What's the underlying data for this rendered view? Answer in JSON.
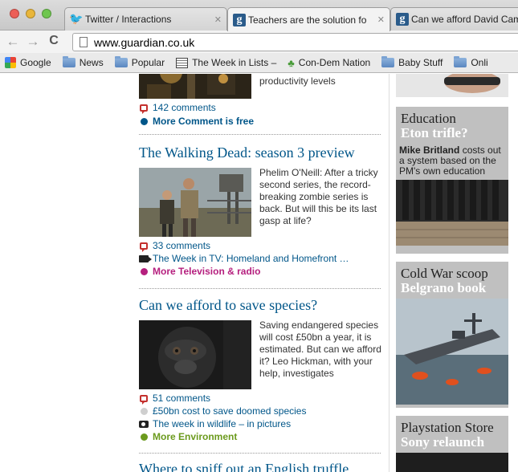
{
  "browser": {
    "tabs": [
      {
        "title": "Twitter / Interactions",
        "favicon": "twitter-icon",
        "active": false
      },
      {
        "title": "Teachers are the solution fo",
        "favicon": "guardian-icon",
        "active": true
      },
      {
        "title": "Can we afford David Came",
        "favicon": "guardian-icon",
        "active": false
      }
    ],
    "url": "www.guardian.co.uk",
    "nav": {
      "back": "←",
      "forward": "→",
      "reload": "C"
    },
    "bookmarks": [
      {
        "label": "Google",
        "icon": "google-icon"
      },
      {
        "label": "News",
        "icon": "folder-icon"
      },
      {
        "label": "Popular",
        "icon": "folder-icon"
      },
      {
        "label": "The Week in Lists – ",
        "icon": "week-icon"
      },
      {
        "label": "Con-Dem Nation",
        "icon": "condem-icon"
      },
      {
        "label": "Baby Stuff",
        "icon": "folder-icon"
      },
      {
        "label": "Onli",
        "icon": "folder-icon"
      }
    ]
  },
  "articles": {
    "a0": {
      "standfirst_tail": "productivity levels",
      "comments": "142 comments",
      "more": "More Comment is free"
    },
    "a1": {
      "title": "The Walking Dead: season 3 preview",
      "standfirst": "Phelim O'Neill: After a tricky second series, the record-breaking zombie series is back. But will this be its last gasp at life?",
      "comments": "33 comments",
      "related": "The Week in TV: Homeland and Homefront …",
      "more": "More Television & radio"
    },
    "a2": {
      "title": "Can we afford to save species?",
      "standfirst": "Saving endangered species will cost £50bn a year, it is estimated. But can we afford it? Leo Hickman, with your help, investigates",
      "comments": "51 comments",
      "related1": "£50bn cost to save doomed species",
      "related2": "The week in wildlife – in pictures",
      "more": "More Environment"
    },
    "a3": {
      "title": "Where to sniff out an English truffle"
    }
  },
  "promos": {
    "p1": {
      "title": "Education",
      "subtitle": "Eton trifle?",
      "byline_name": "Mike Britland",
      "byline_text": " costs out a system based on the PM's own education"
    },
    "p2": {
      "title": "Cold War scoop",
      "subtitle": "Belgrano book"
    },
    "p3": {
      "title": "Playstation Store",
      "subtitle": "Sony relaunch"
    }
  },
  "colors": {
    "link": "#005689",
    "comment_is_free": "#005689",
    "television": "#b51f7e",
    "environment": "#6b9a1d",
    "comments_icon": "#c4312e",
    "promo_bg": "#c0c0c0"
  }
}
